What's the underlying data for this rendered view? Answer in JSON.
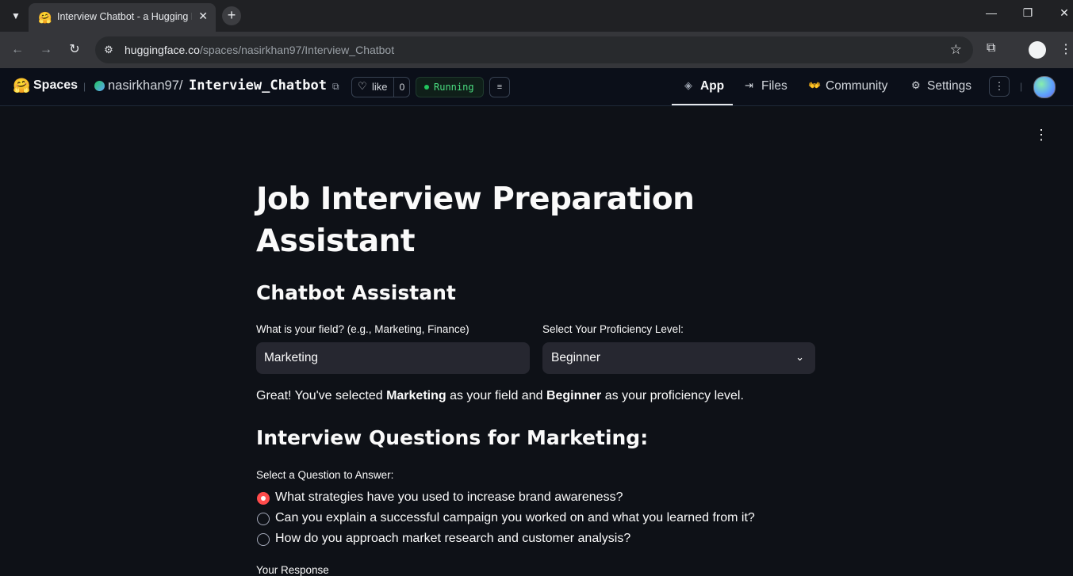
{
  "browser": {
    "tab_title": "Interview Chatbot - a Hugging Fa",
    "url_host": "huggingface.co",
    "url_path": "/spaces/nasirkhan97/Interview_Chatbot"
  },
  "hf_header": {
    "brand": "Spaces",
    "owner": "nasirkhan97",
    "slash": "/",
    "repo": "Interview_Chatbot",
    "like_label": "like",
    "like_count": "0",
    "status": "Running",
    "nav": {
      "app": "App",
      "files": "Files",
      "community": "Community",
      "settings": "Settings"
    }
  },
  "app": {
    "title": "Job Interview Preparation Assistant",
    "subtitle": "Chatbot Assistant",
    "field_label": "What is your field? (e.g., Marketing, Finance)",
    "field_value": "Marketing",
    "level_label": "Select Your Proficiency Level:",
    "level_value": "Beginner",
    "confirm": {
      "p1": "Great! You've selected ",
      "field": "Marketing",
      "p2": " as your field and ",
      "level": "Beginner",
      "p3": " as your proficiency level."
    },
    "questions_heading": "Interview Questions for Marketing:",
    "radio_label": "Select a Question to Answer:",
    "questions": [
      "What strategies have you used to increase brand awareness?",
      "Can you explain a successful campaign you worked on and what you learned from it?",
      "How do you approach market research and customer analysis?"
    ],
    "selected_question_index": 0,
    "response_label": "Your Response"
  },
  "colors": {
    "accent": "#ff4b4b",
    "background": "#0e1117",
    "input_bg": "#262730",
    "running": "#22c55e"
  }
}
